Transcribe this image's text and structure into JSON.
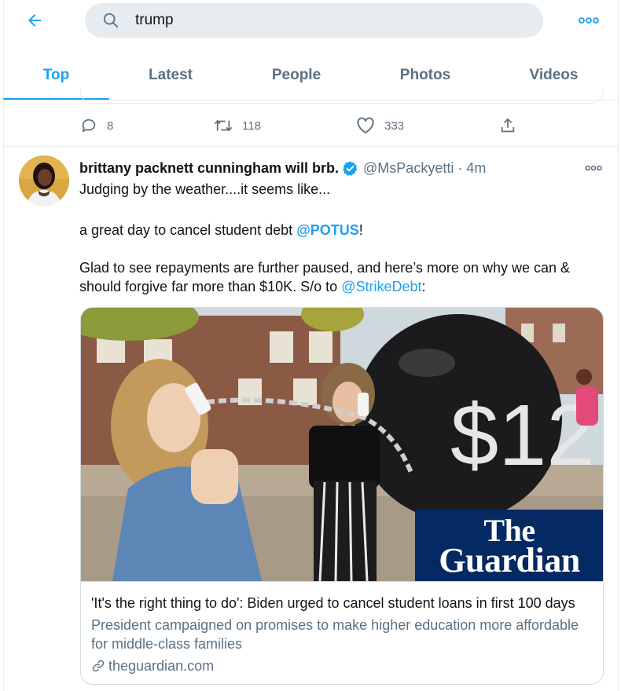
{
  "search": {
    "query": "trump"
  },
  "tabs": [
    {
      "label": "Top",
      "active": true
    },
    {
      "label": "Latest",
      "active": false
    },
    {
      "label": "People",
      "active": false
    },
    {
      "label": "Photos",
      "active": false
    },
    {
      "label": "Videos",
      "active": false
    }
  ],
  "previous_tweet": {
    "replies": "8",
    "retweets": "118",
    "likes": "333"
  },
  "tweet": {
    "display_name": "brittany packnett cunningham will brb.",
    "verified": true,
    "handle": "@MsPackyetti",
    "separator": "·",
    "timestamp": "4m",
    "line1": "Judging by the weather....it seems like...",
    "line2_prefix": "a great day to cancel student debt ",
    "line2_mention": "@POTUS",
    "line2_suffix": "!",
    "line3": "Glad to see repayments are further paused, and here’s more on why we can & should forgive far more than $10K. S/o to ",
    "line3_mention": "@StrikeDebt",
    "line3_suffix": ":"
  },
  "card": {
    "logo_line1": "The",
    "logo_line2": "Guardian",
    "ball_text": "$12",
    "title": "'It's the right thing to do': Biden urged to cancel student loans in first 100 days",
    "description": "President campaigned on promises to make higher education more affordable for middle-class families",
    "domain": "theguardian.com"
  },
  "colors": {
    "accent": "#1da1f2",
    "secondary_text": "#5b7083",
    "search_bg": "#e6ecf0",
    "guardian_blue": "#052962"
  },
  "icons": {
    "back": "arrow-left-icon",
    "search": "search-icon",
    "more": "more-horizontal-icon",
    "reply": "reply-icon",
    "retweet": "retweet-icon",
    "like": "heart-icon",
    "share": "share-icon",
    "verified": "verified-badge-icon",
    "link": "link-icon"
  }
}
